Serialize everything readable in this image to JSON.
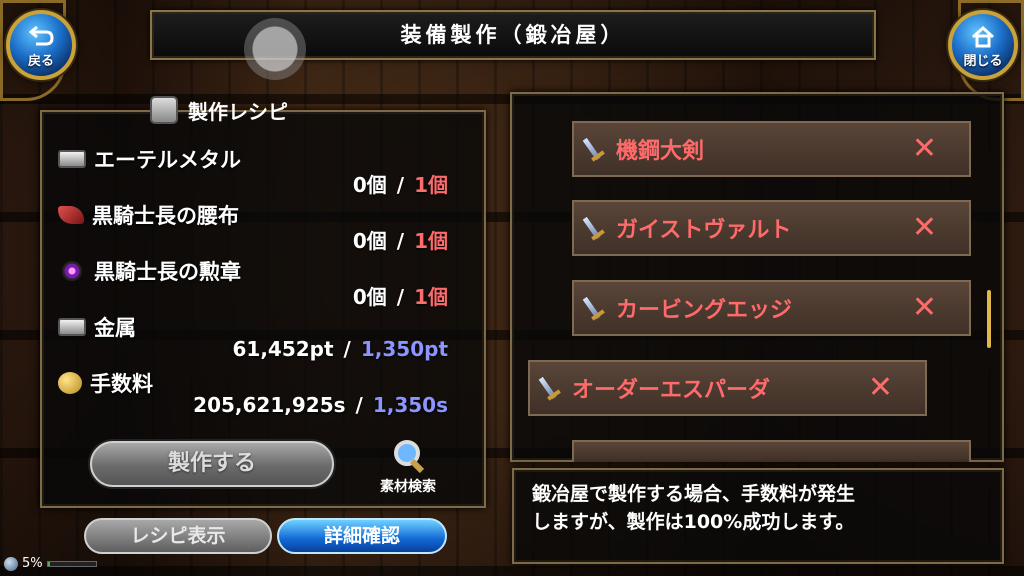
{
  "header": {
    "title": "装備製作（鍛冶屋）",
    "back_label": "戻る",
    "close_label": "閉じる"
  },
  "recipe": {
    "title": "製作レシピ",
    "materials": [
      {
        "name": "エーテルメタル",
        "have": "0個",
        "need": "1個",
        "icon": "metal-ingot-icon"
      },
      {
        "name": "黒騎士長の腰布",
        "have": "0個",
        "need": "1個",
        "icon": "cloth-icon"
      },
      {
        "name": "黒騎士長の勲章",
        "have": "0個",
        "need": "1個",
        "icon": "medal-icon"
      },
      {
        "name": "金属",
        "have": "61,452pt",
        "need": "1,350pt",
        "icon": "metal-ingot-icon"
      },
      {
        "name": "手数料",
        "have": "205,621,925s",
        "need": "1,350s",
        "icon": "coin-icon"
      }
    ],
    "craft_label": "製作する",
    "search_label": "素材検索",
    "recipe_view_label": "レシピ表示",
    "detail_label": "詳細確認"
  },
  "equipment_list": [
    {
      "name": "機鋼大剣",
      "mark": "✕"
    },
    {
      "name": "ガイストヴァルト",
      "mark": "✕"
    },
    {
      "name": "カービングエッジ",
      "mark": "✕"
    },
    {
      "name": "オーダーエスパーダ",
      "mark": "✕"
    }
  ],
  "info": {
    "line1": "鍛冶屋で製作する場合、手数料が発生",
    "line2": "しますが、製作は100%成功します。"
  },
  "status": {
    "battery": "5%",
    "battery_level": 0.05
  },
  "colors": {
    "required": "#ff6b6b",
    "required_points": "#8c95ff",
    "accent_gold": "#c9a23a"
  }
}
